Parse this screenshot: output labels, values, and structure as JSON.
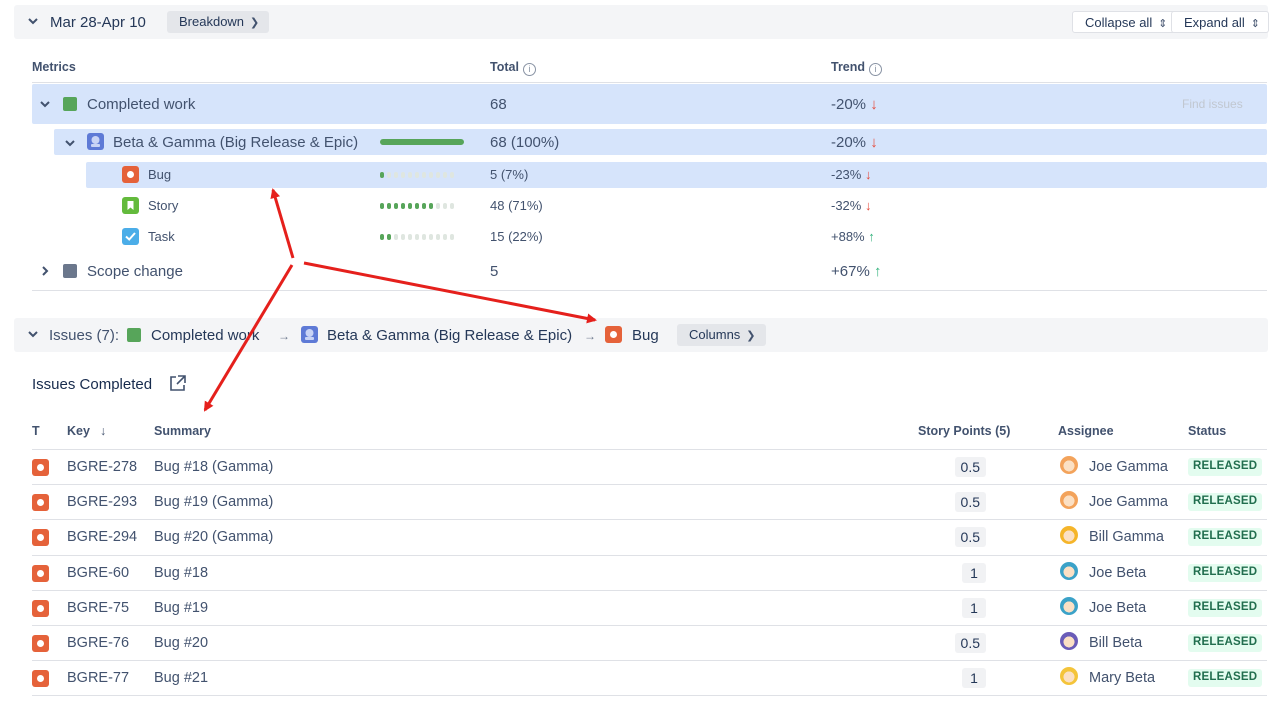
{
  "period_bar": {
    "date_range": "Mar 28-Apr 10",
    "breakdown_label": "Breakdown",
    "collapse_label": "Collapse all",
    "expand_label": "Expand all"
  },
  "metrics": {
    "headers": {
      "metrics": "Metrics",
      "total": "Total",
      "trend": "Trend"
    },
    "find_issues": "Find issues",
    "completed": {
      "label": "Completed work",
      "total": "68",
      "trend": "-20%",
      "color": "#57a55a"
    },
    "group": {
      "label": "Beta & Gamma (Big Release & Epic)",
      "total": "68 (100%)",
      "trend": "-20%",
      "progress": 1.0
    },
    "types": [
      {
        "label": "Bug",
        "total": "5 (7%)",
        "trend": "-23%",
        "direction": "down",
        "share": 0.07
      },
      {
        "label": "Story",
        "total": "48 (71%)",
        "trend": "-32%",
        "direction": "down",
        "share": 0.71
      },
      {
        "label": "Task",
        "total": "15 (22%)",
        "trend": "+88%",
        "direction": "up",
        "share": 0.22
      }
    ],
    "scope": {
      "label": "Scope change",
      "total": "5",
      "trend": "+67%",
      "color": "#6b778c"
    }
  },
  "issues_bar": {
    "prefix": "Issues (7):",
    "crumb1": "Completed work",
    "crumb2": "Beta & Gamma (Big Release & Epic)",
    "crumb3": "Bug",
    "columns_label": "Columns",
    "sep": "→"
  },
  "issues_section": {
    "title": "Issues Completed"
  },
  "table": {
    "headers": {
      "t": "T",
      "key": "Key",
      "summary": "Summary",
      "points": "Story Points (5)",
      "assignee": "Assignee",
      "status": "Status"
    },
    "rows": [
      {
        "key": "BGRE-278",
        "summary": "Bug #18 (Gamma)",
        "points": "0.5",
        "assignee": "Joe Gamma",
        "status": "RELEASED",
        "avatar_color": "#f3a35b"
      },
      {
        "key": "BGRE-293",
        "summary": "Bug #19 (Gamma)",
        "points": "0.5",
        "assignee": "Joe Gamma",
        "status": "RELEASED",
        "avatar_color": "#f3a35b"
      },
      {
        "key": "BGRE-294",
        "summary": "Bug #20 (Gamma)",
        "points": "0.5",
        "assignee": "Bill Gamma",
        "status": "RELEASED",
        "avatar_color": "#f5b52a"
      },
      {
        "key": "BGRE-60",
        "summary": "Bug #18",
        "points": "1",
        "assignee": "Joe Beta",
        "status": "RELEASED",
        "avatar_color": "#3ba2c8"
      },
      {
        "key": "BGRE-75",
        "summary": "Bug #19",
        "points": "1",
        "assignee": "Joe Beta",
        "status": "RELEASED",
        "avatar_color": "#3ba2c8"
      },
      {
        "key": "BGRE-76",
        "summary": "Bug #20",
        "points": "0.5",
        "assignee": "Bill Beta",
        "status": "RELEASED",
        "avatar_color": "#6a5cb8"
      },
      {
        "key": "BGRE-77",
        "summary": "Bug #21",
        "points": "1",
        "assignee": "Mary Beta",
        "status": "RELEASED",
        "avatar_color": "#f4c43a"
      }
    ]
  }
}
